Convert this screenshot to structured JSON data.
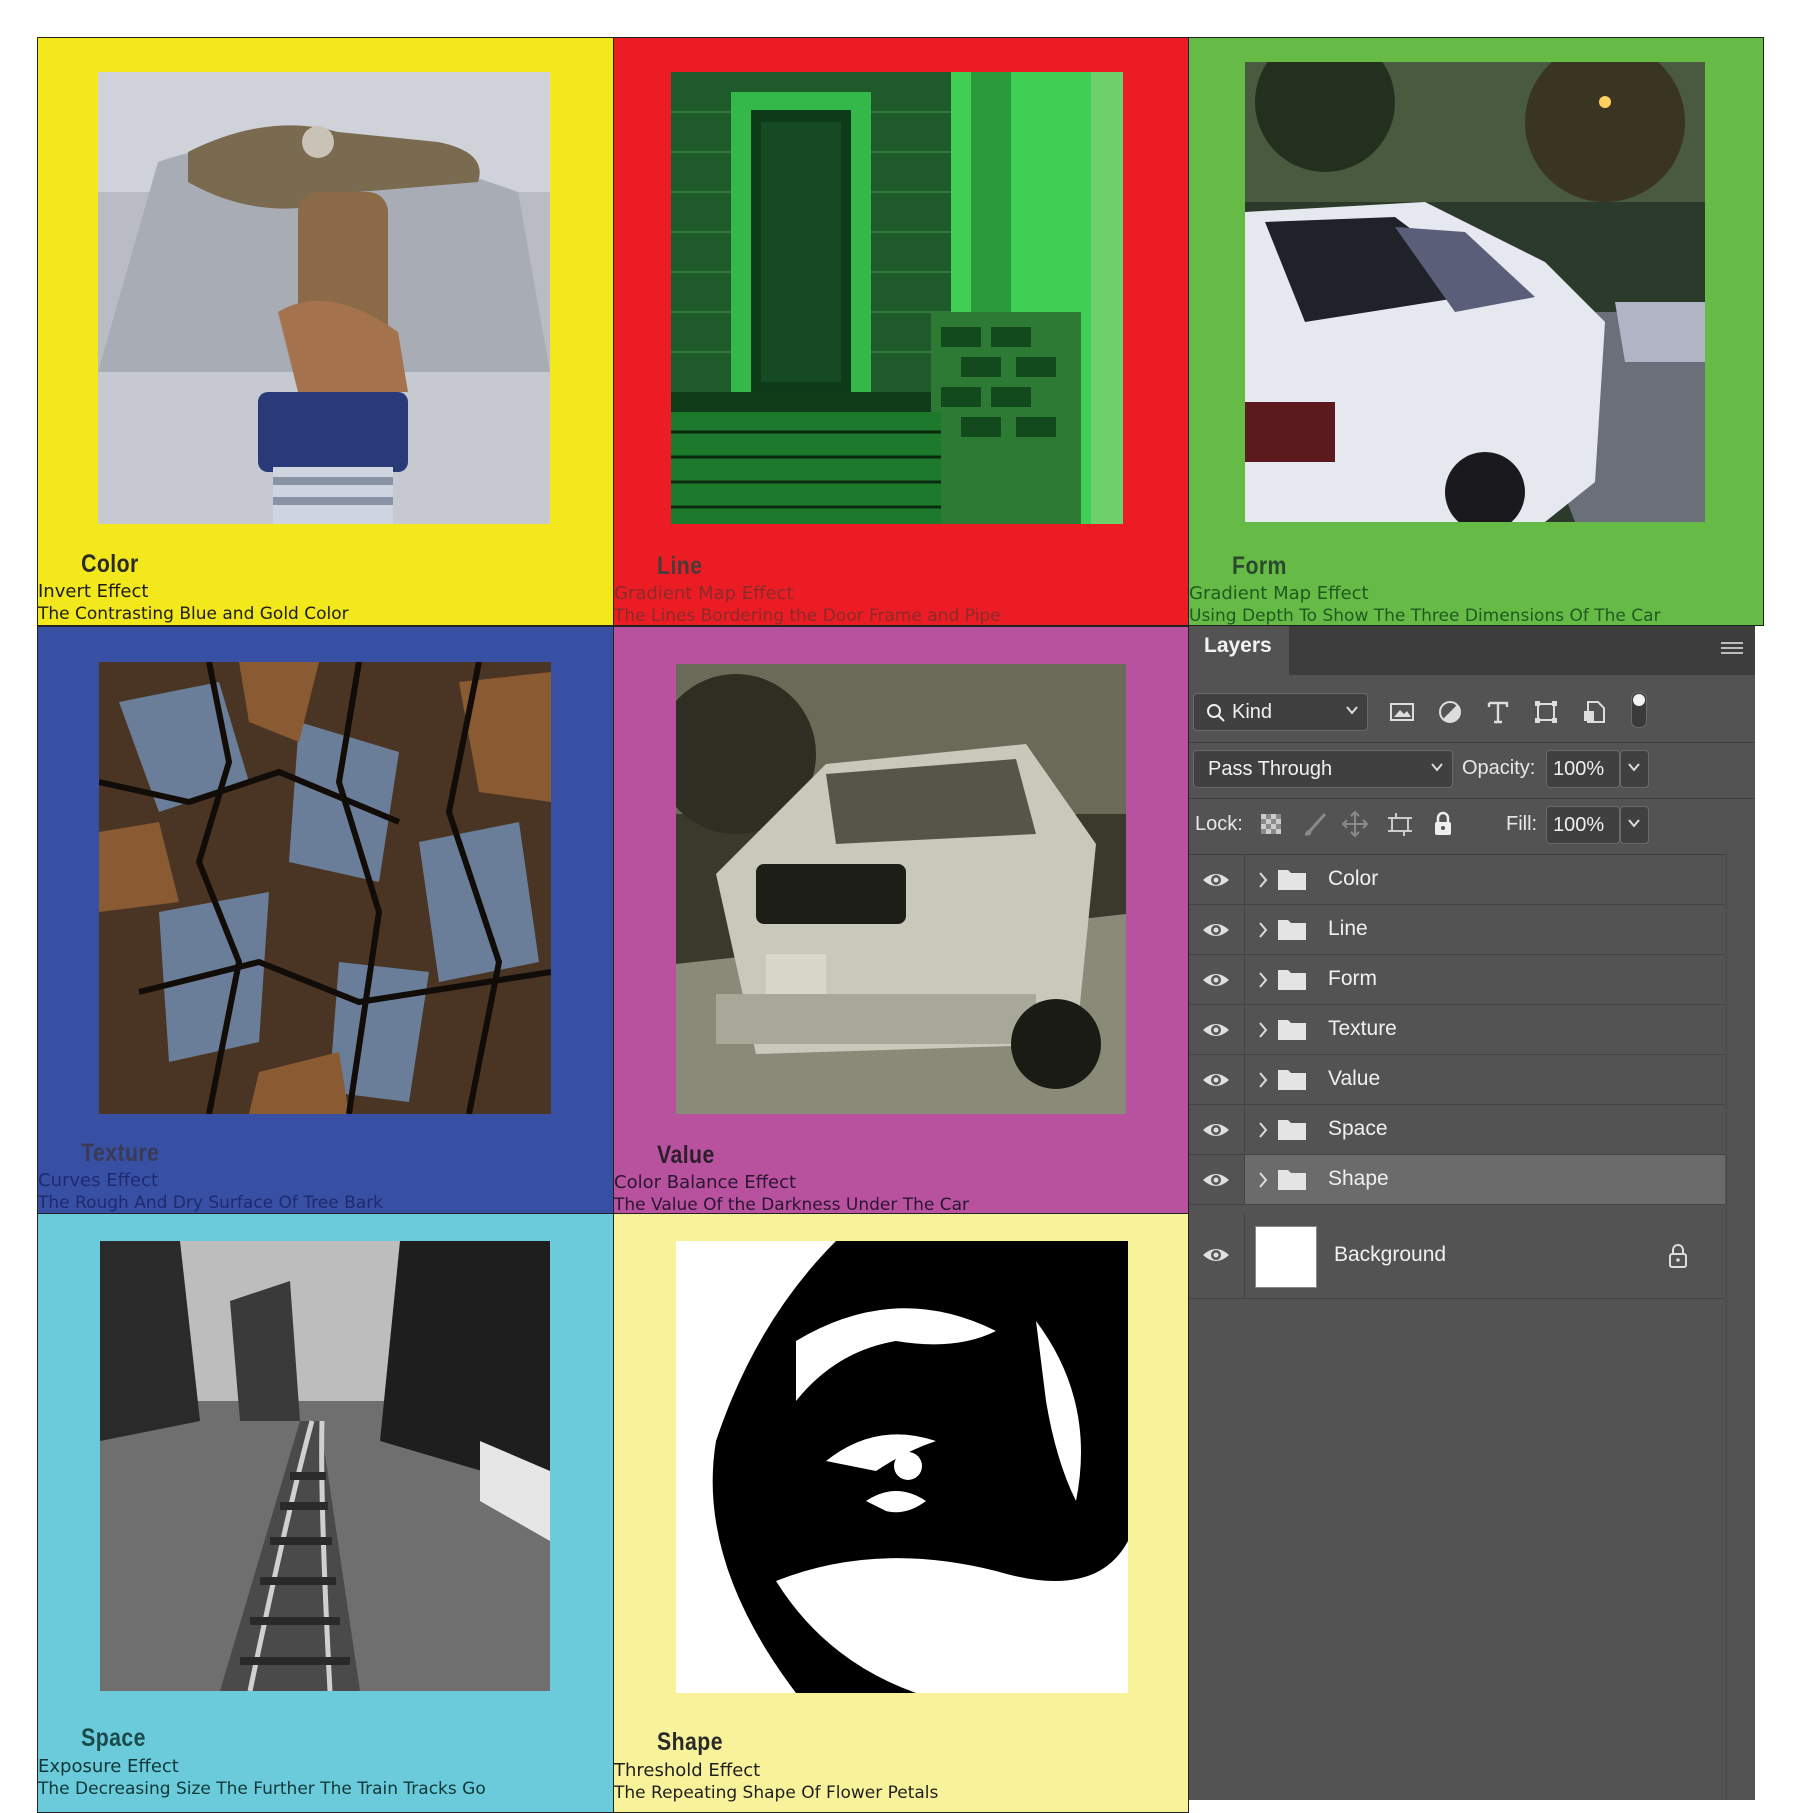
{
  "tiles": [
    {
      "title": "Color",
      "effect": "Invert Effect",
      "description": "The Contrasting Blue and Gold Color",
      "bg": "#f2e81b",
      "title_color": "#2a2a2a",
      "text_color": "#1d1d1d"
    },
    {
      "title": "Line",
      "effect": "Gradient Map Effect",
      "description": "The Lines Bordering the Door Frame and Pipe",
      "bg": "#ec1c24",
      "title_color": "#4a3a3a",
      "text_color": "#8a2b2b"
    },
    {
      "title": "Form",
      "effect": "Gradient Map Effect",
      "description": "Using Depth To Show The Three Dimensions Of The Car",
      "bg": "#66bb47",
      "title_color": "#2b4a2b",
      "text_color": "#1f5a1f"
    },
    {
      "title": "Texture",
      "effect": "Curves Effect",
      "description": "The Rough And Dry Surface Of Tree Bark",
      "bg": "#3850a3",
      "title_color": "#3a3a55",
      "text_color": "#1e2a70"
    },
    {
      "title": "Value",
      "effect": "Color Balance Effect",
      "description": "The Value Of the Darkness Under The Car",
      "bg": "#b8529f",
      "title_color": "#2a1e2a",
      "text_color": "#2a1530"
    },
    {
      "title": "Space",
      "effect": "Exposure Effect",
      "description": "The Decreasing Size The Further The Train Tracks Go",
      "bg": "#6bcbdb",
      "title_color": "#1a4a4a",
      "text_color": "#103838"
    },
    {
      "title": "Shape",
      "effect": "Threshold Effect",
      "description": "The Repeating Shape Of Flower Petals",
      "bg": "#f8f39b",
      "title_color": "#2a2a2a",
      "text_color": "#1f1f1f"
    }
  ],
  "layers_panel": {
    "tab_label": "Layers",
    "filter_label": "Kind",
    "blend_mode": "Pass Through",
    "opacity_label": "Opacity:",
    "opacity_value": "100%",
    "lock_label": "Lock:",
    "fill_label": "Fill:",
    "fill_value": "100%",
    "layers": [
      {
        "name": "Color",
        "type": "group"
      },
      {
        "name": "Line",
        "type": "group"
      },
      {
        "name": "Form",
        "type": "group"
      },
      {
        "name": "Texture",
        "type": "group"
      },
      {
        "name": "Value",
        "type": "group"
      },
      {
        "name": "Space",
        "type": "group"
      },
      {
        "name": "Shape",
        "type": "group",
        "selected": true
      }
    ],
    "background_layer": "Background",
    "icons": [
      "search-icon",
      "chevron-down-icon",
      "image-filter-icon",
      "adjustment-filter-icon",
      "type-filter-icon",
      "shape-filter-icon",
      "smart-object-filter-icon",
      "filter-toggle-icon",
      "lock-transparent-icon",
      "lock-paint-icon",
      "lock-move-icon",
      "lock-artboard-icon",
      "lock-all-icon",
      "eye-icon",
      "folder-icon",
      "lock-icon",
      "panel-menu-icon"
    ]
  }
}
